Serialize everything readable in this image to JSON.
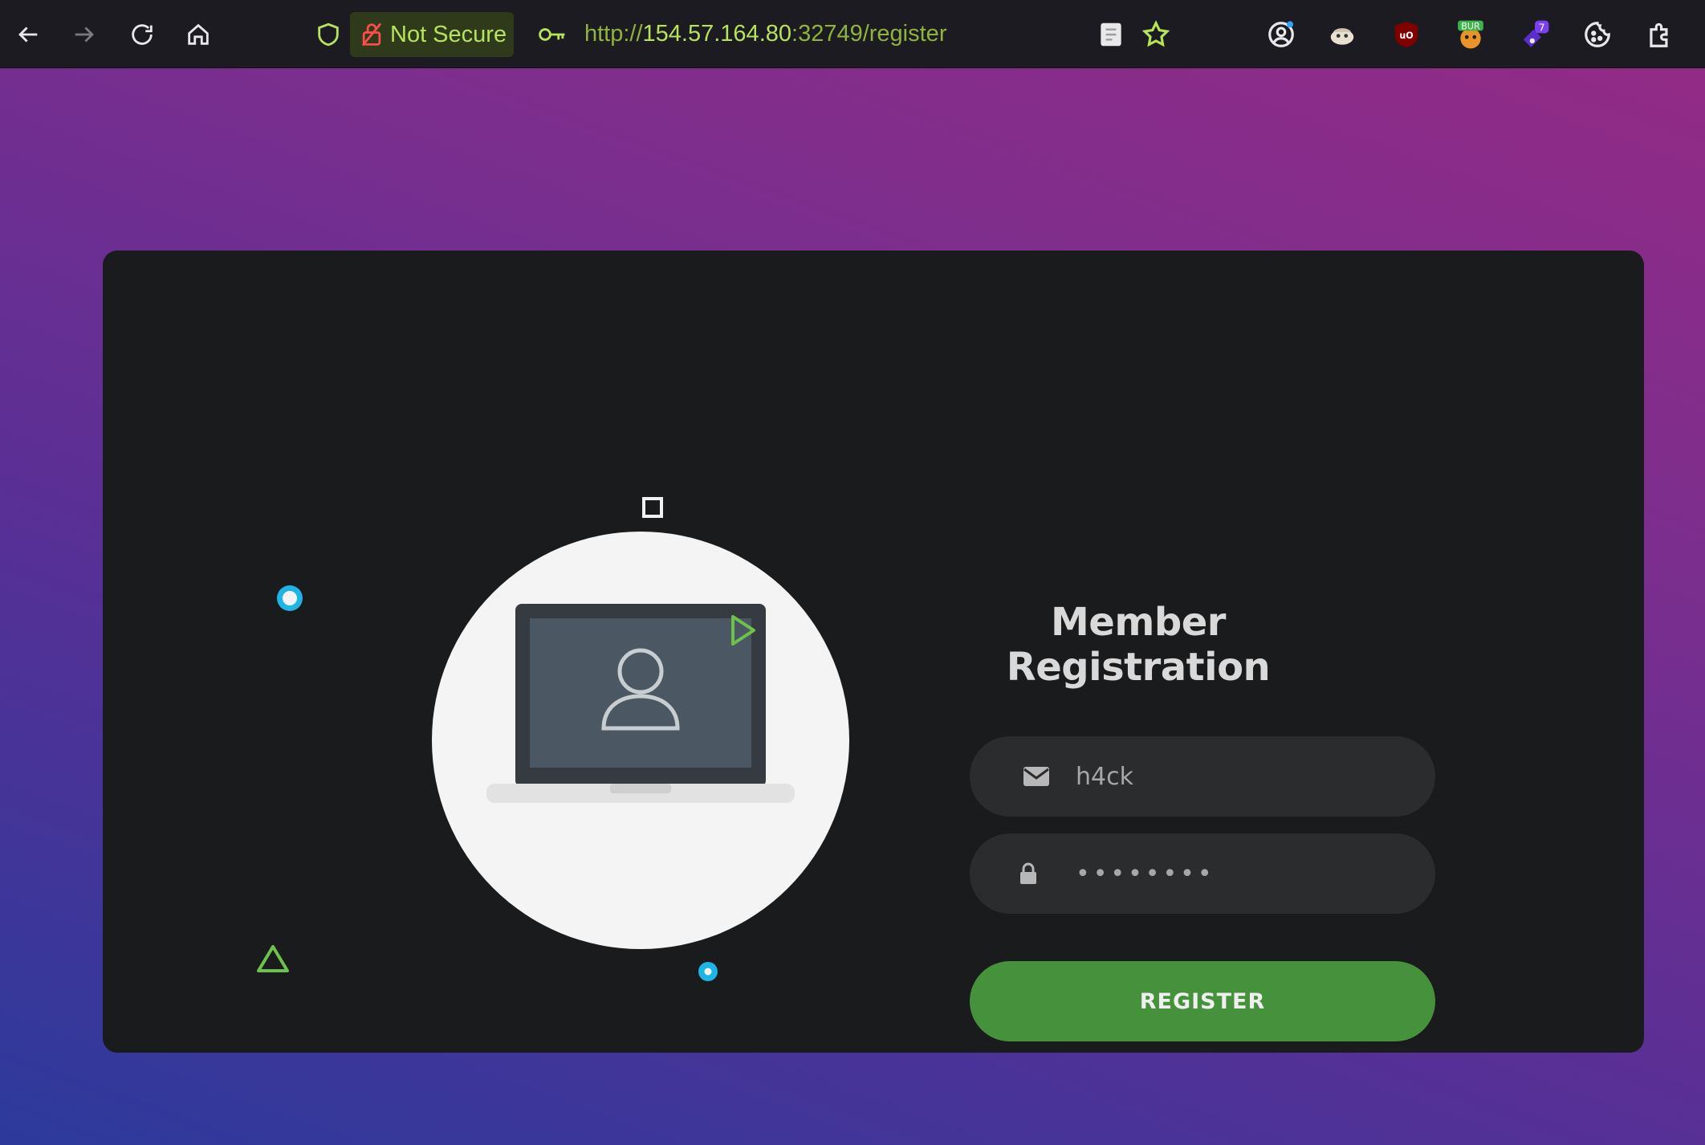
{
  "browser": {
    "security_label": "Not Secure",
    "url_scheme": "http://",
    "url_host": "154.57.164.80",
    "url_rest": ":32749/register",
    "extensions": [
      "account-icon",
      "mascot-extension-icon",
      "ublock-icon",
      "burp-extension-icon",
      "badge-extension-icon",
      "cookie-icon",
      "extensions-icon"
    ],
    "badge_count": "7",
    "burp_label": "BUR"
  },
  "form": {
    "title": "Member Registration",
    "username_value": "h4ck",
    "password_value": "••••••••",
    "submit_label": "REGISTER"
  },
  "colors": {
    "accent_green": "#46923c",
    "card_bg": "#1a1b1d",
    "cyan_deco": "#1eb4e6"
  }
}
